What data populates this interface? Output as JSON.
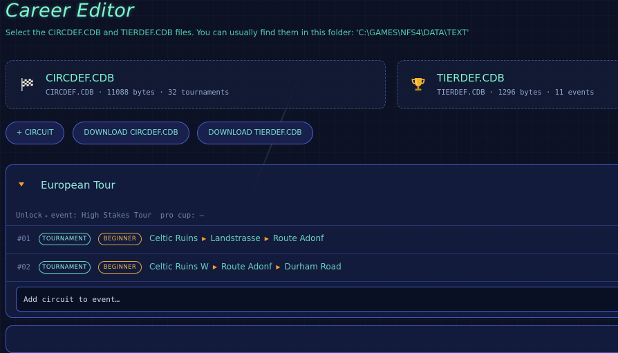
{
  "header": {
    "title": "Career Editor",
    "subtitle": "Select the CIRCDEF.CDB and TIERDEF.CDB files. You can usually find them in this folder: 'C:\\GAMES\\NFS4\\DATA\\TEXT'"
  },
  "files": [
    {
      "name": "CIRCDEF.CDB",
      "meta": "CIRCDEF.CDB · 11088 bytes · 32 tournaments",
      "icon": "checkered-flag-icon"
    },
    {
      "name": "TIERDEF.CDB",
      "meta": "TIERDEF.CDB · 1296 bytes · 11 events",
      "icon": "trophy-icon"
    }
  ],
  "actions": {
    "add_circuit": "+ CIRCUIT",
    "download_circdef": "DOWNLOAD CIRCDEF.CDB",
    "download_tierdef": "DOWNLOAD TIERDEF.CDB"
  },
  "event": {
    "name": "European Tour",
    "unlock_label": "Unlock",
    "unlock_event": "event: High Stakes Tour",
    "unlock_cup": "pro cup: —",
    "circuits": [
      {
        "num": "#01",
        "type": "TOURNAMENT",
        "level": "BEGINNER",
        "tracks": [
          "Celtic Ruins",
          "Landstrasse",
          "Route Adonf"
        ]
      },
      {
        "num": "#02",
        "type": "TOURNAMENT",
        "level": "BEGINNER",
        "tracks": [
          "Celtic Ruins W",
          "Route Adonf",
          "Durham Road"
        ]
      }
    ],
    "add_placeholder": "Add circuit to event…"
  },
  "colors": {
    "accent": "#7ff5cf",
    "border": "#3e56c4",
    "beginner": "#e4a63d",
    "background": "#0c1224"
  }
}
